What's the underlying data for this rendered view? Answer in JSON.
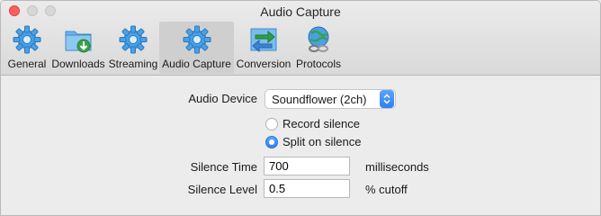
{
  "window": {
    "title": "Audio Capture"
  },
  "toolbar": {
    "items": [
      {
        "label": "General",
        "icon": "gear-icon"
      },
      {
        "label": "Downloads",
        "icon": "downloads-folder-icon"
      },
      {
        "label": "Streaming",
        "icon": "gear-icon"
      },
      {
        "label": "Audio Capture",
        "icon": "gear-icon",
        "selected": true
      },
      {
        "label": "Conversion",
        "icon": "conversion-icon"
      },
      {
        "label": "Protocols",
        "icon": "globe-chain-icon"
      }
    ]
  },
  "form": {
    "audio_device_label": "Audio Device",
    "audio_device_value": "Soundflower (2ch)",
    "record_silence_label": "Record silence",
    "split_on_silence_label": "Split on silence",
    "selected_mode": "Split on silence",
    "silence_time_label": "Silence Time",
    "silence_time_value": "700",
    "silence_time_unit": "milliseconds",
    "silence_level_label": "Silence Level",
    "silence_level_value": "0.5",
    "silence_level_unit": "% cutoff"
  },
  "colors": {
    "accent": "#2f7ff2",
    "close": "#fc605c"
  }
}
